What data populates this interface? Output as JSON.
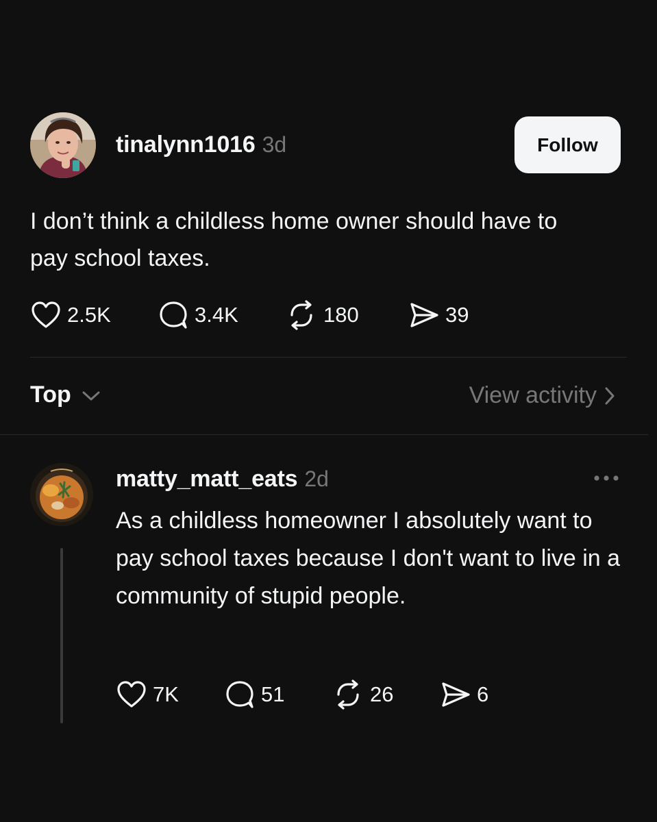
{
  "post": {
    "author": "tinalynn1016",
    "time": "3d",
    "follow_label": "Follow",
    "text": "I don’t think a childless home owner should have to pay school taxes.",
    "stats": {
      "likes": "2.5K",
      "comments": "3.4K",
      "reposts": "180",
      "shares": "39"
    },
    "avatar_icon": "profile-photo-avatar"
  },
  "sort": {
    "label": "Top",
    "icon": "chevron-down-icon"
  },
  "view_activity": {
    "label": "View activity",
    "icon": "chevron-right-icon"
  },
  "reply": {
    "author": "matty_matt_eats",
    "time": "2d",
    "text": "As a childless homeowner I absolutely want to pay school taxes because I don't want to live in a community of stupid people.",
    "stats": {
      "likes": "7K",
      "comments": "51",
      "reposts": "26",
      "shares": "6"
    },
    "avatar_icon": "food-bowl-avatar",
    "more_icon": "more-options-icon"
  },
  "colors": {
    "background": "#101010",
    "text": "#f3f5f7",
    "muted": "#777777",
    "divider": "#2a2a2a",
    "follow_button_bg": "#f3f5f7"
  }
}
